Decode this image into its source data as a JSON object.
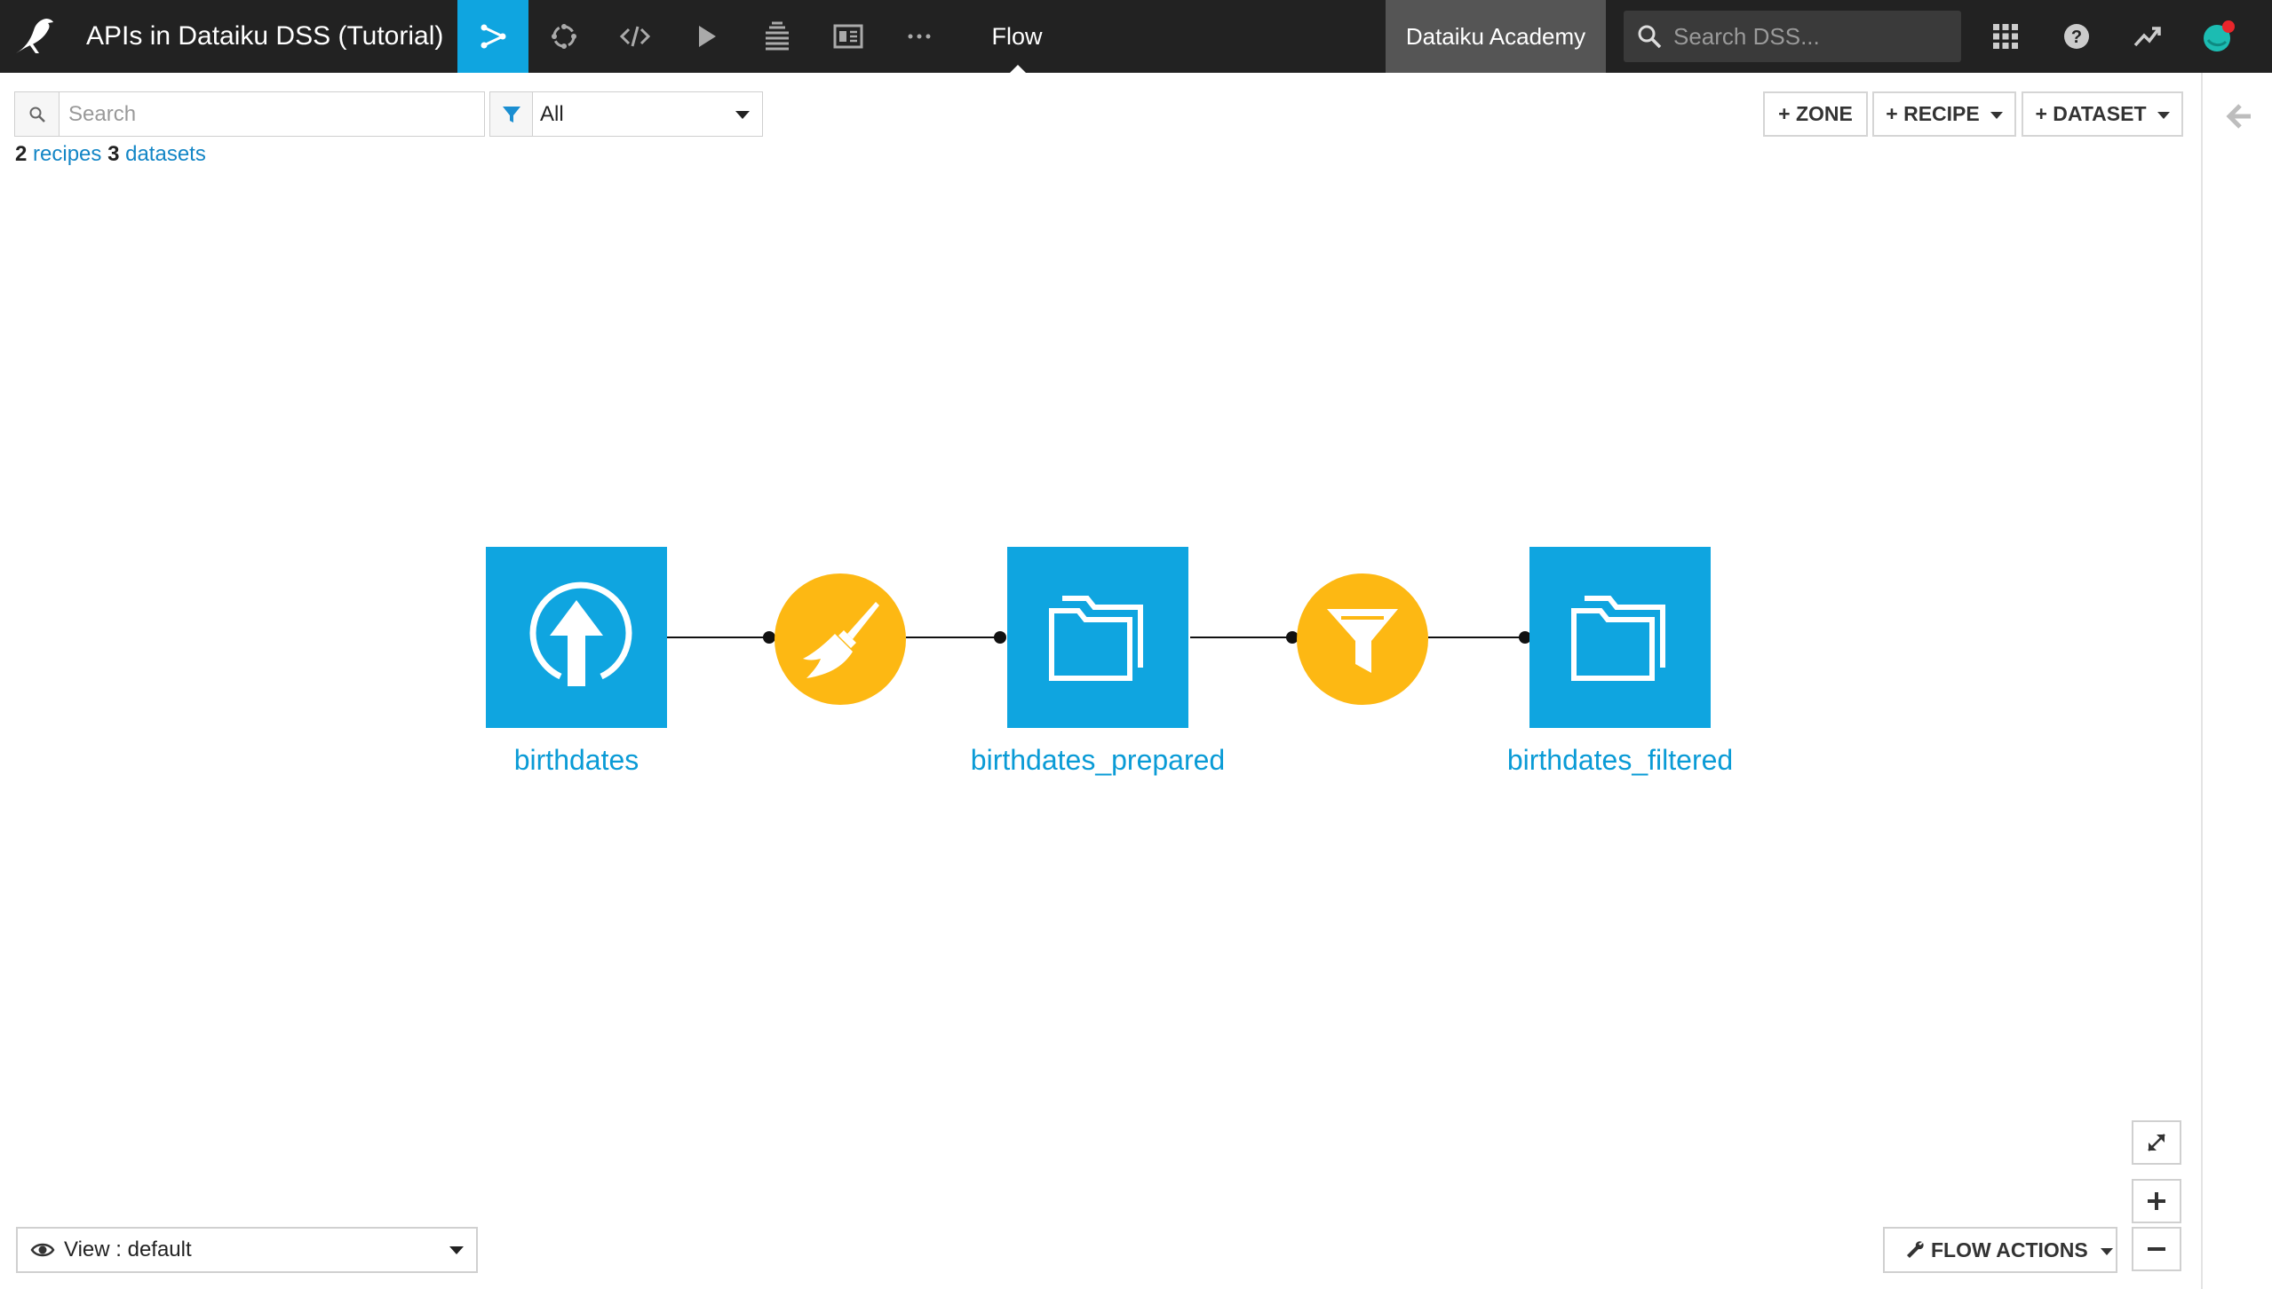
{
  "navbar": {
    "project_title": "APIs in Dataiku DSS (Tutorial)",
    "icons": [
      "flow-icon",
      "jobs-icon",
      "code-icon",
      "run-icon",
      "stack-icon",
      "dashboard-icon",
      "more-icon"
    ],
    "current_section": "Flow",
    "academy_label": "Dataiku Academy",
    "search_placeholder": "Search DSS...",
    "right_icons": [
      "apps-grid-icon",
      "help-icon",
      "activity-icon",
      "avatar"
    ]
  },
  "colors": {
    "navbar_bg": "#222222",
    "accent": "#0fa5e0",
    "dataset": "#0fa5e0",
    "recipe": "#fdb813",
    "link": "#1386c6",
    "notification": "#e8262b"
  },
  "toolbar": {
    "search_placeholder": "Search",
    "filter_value": "All",
    "zone_label": "+ ZONE",
    "recipe_label": "+ RECIPE",
    "dataset_label": "+ DATASET"
  },
  "summary": {
    "recipes_count": "2",
    "recipes_label": "recipes",
    "datasets_count": "3",
    "datasets_label": "datasets"
  },
  "flow": {
    "datasets": [
      {
        "name": "birthdates",
        "icon": "upload-icon"
      },
      {
        "name": "birthdates_prepared",
        "icon": "folder-icon"
      },
      {
        "name": "birthdates_filtered",
        "icon": "folder-icon"
      }
    ],
    "recipes": [
      {
        "type": "prepare",
        "icon": "broom-icon"
      },
      {
        "type": "filter",
        "icon": "funnel-icon"
      }
    ]
  },
  "bottom": {
    "view_label": "View : default",
    "flow_actions_label": "FLOW ACTIONS"
  }
}
